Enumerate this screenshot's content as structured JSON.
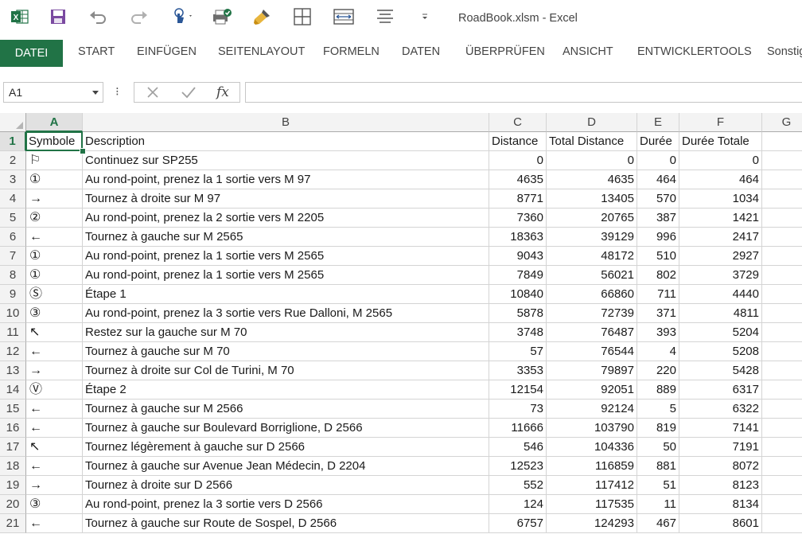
{
  "window": {
    "title": "RoadBook.xlsm - Excel"
  },
  "quick_access": [
    {
      "name": "excel-logo-icon"
    },
    {
      "name": "save-icon"
    },
    {
      "name": "undo-icon"
    },
    {
      "name": "redo-icon"
    },
    {
      "name": "touch-mode-icon"
    },
    {
      "name": "print-preview-icon"
    },
    {
      "name": "format-painter-icon"
    },
    {
      "name": "borders-icon"
    },
    {
      "name": "merge-cells-icon"
    },
    {
      "name": "align-icon"
    },
    {
      "name": "customize-qat-icon"
    }
  ],
  "ribbon": {
    "tabs": [
      "DATEI",
      "START",
      "EINFÜGEN",
      "SEITENLAYOUT",
      "FORMELN",
      "DATEN",
      "ÜBERPRÜFEN",
      "ANSICHT",
      "ENTWICKLERTOOLS",
      "Sonstig"
    ]
  },
  "formula_bar": {
    "name_box": "A1",
    "formula": "",
    "fx_label": "fx",
    "dots": "⁝"
  },
  "sheet": {
    "columns": [
      "A",
      "B",
      "C",
      "D",
      "E",
      "F",
      "G"
    ],
    "selected_cell": "A1",
    "rows": [
      {
        "n": "1",
        "sym": "Symbole",
        "desc": "Description",
        "c": "Distance",
        "d": "Total Distance",
        "e": "Durée",
        "f": "Durée Totale"
      },
      {
        "n": "2",
        "sym": "⚐",
        "desc": "Continuez sur SP255",
        "c": "0",
        "d": "0",
        "e": "0",
        "f": "0"
      },
      {
        "n": "3",
        "sym": "①",
        "desc": "Au rond-point, prenez la 1 sortie vers M 97",
        "c": "4635",
        "d": "4635",
        "e": "464",
        "f": "464"
      },
      {
        "n": "4",
        "sym": "→",
        "desc": "Tournez à droite sur M 97",
        "c": "8771",
        "d": "13405",
        "e": "570",
        "f": "1034"
      },
      {
        "n": "5",
        "sym": "②",
        "desc": "Au rond-point, prenez la 2 sortie vers M 2205",
        "c": "7360",
        "d": "20765",
        "e": "387",
        "f": "1421"
      },
      {
        "n": "6",
        "sym": "←",
        "desc": "Tournez à gauche sur M 2565",
        "c": "18363",
        "d": "39129",
        "e": "996",
        "f": "2417"
      },
      {
        "n": "7",
        "sym": "①",
        "desc": "Au rond-point, prenez la 1 sortie vers M 2565",
        "c": "9043",
        "d": "48172",
        "e": "510",
        "f": "2927"
      },
      {
        "n": "8",
        "sym": "①",
        "desc": "Au rond-point, prenez la 1 sortie vers M 2565",
        "c": "7849",
        "d": "56021",
        "e": "802",
        "f": "3729"
      },
      {
        "n": "9",
        "sym": "Ⓢ",
        "desc": "Étape 1",
        "c": "10840",
        "d": "66860",
        "e": "711",
        "f": "4440"
      },
      {
        "n": "10",
        "sym": "③",
        "desc": "Au rond-point, prenez la 3 sortie vers Rue Dalloni, M 2565",
        "c": "5878",
        "d": "72739",
        "e": "371",
        "f": "4811"
      },
      {
        "n": "11",
        "sym": "↖",
        "desc": "Restez sur la gauche sur M 70",
        "c": "3748",
        "d": "76487",
        "e": "393",
        "f": "5204"
      },
      {
        "n": "12",
        "sym": "←",
        "desc": "Tournez à gauche sur M 70",
        "c": "57",
        "d": "76544",
        "e": "4",
        "f": "5208"
      },
      {
        "n": "13",
        "sym": "→",
        "desc": "Tournez à droite sur Col de Turini, M 70",
        "c": "3353",
        "d": "79897",
        "e": "220",
        "f": "5428"
      },
      {
        "n": "14",
        "sym": "Ⓥ",
        "desc": "Étape 2",
        "c": "12154",
        "d": "92051",
        "e": "889",
        "f": "6317"
      },
      {
        "n": "15",
        "sym": "←",
        "desc": "Tournez à gauche sur M 2566",
        "c": "73",
        "d": "92124",
        "e": "5",
        "f": "6322"
      },
      {
        "n": "16",
        "sym": "←",
        "desc": "Tournez à gauche sur Boulevard Borriglione, D 2566",
        "c": "11666",
        "d": "103790",
        "e": "819",
        "f": "7141"
      },
      {
        "n": "17",
        "sym": "↖",
        "desc": "Tournez légèrement à gauche sur D 2566",
        "c": "546",
        "d": "104336",
        "e": "50",
        "f": "7191"
      },
      {
        "n": "18",
        "sym": "←",
        "desc": "Tournez à gauche sur Avenue Jean Médecin, D 2204",
        "c": "12523",
        "d": "116859",
        "e": "881",
        "f": "8072"
      },
      {
        "n": "19",
        "sym": "→",
        "desc": "Tournez à droite sur D 2566",
        "c": "552",
        "d": "117412",
        "e": "51",
        "f": "8123"
      },
      {
        "n": "20",
        "sym": "③",
        "desc": "Au rond-point, prenez la 3 sortie vers D 2566",
        "c": "124",
        "d": "117535",
        "e": "11",
        "f": "8134"
      },
      {
        "n": "21",
        "sym": "←",
        "desc": "Tournez à gauche sur Route de Sospel, D 2566",
        "c": "6757",
        "d": "124293",
        "e": "467",
        "f": "8601"
      }
    ]
  },
  "colors": {
    "accent": "#217346",
    "header_bg": "#f3f3f3",
    "gridline": "#d4d4d4"
  }
}
